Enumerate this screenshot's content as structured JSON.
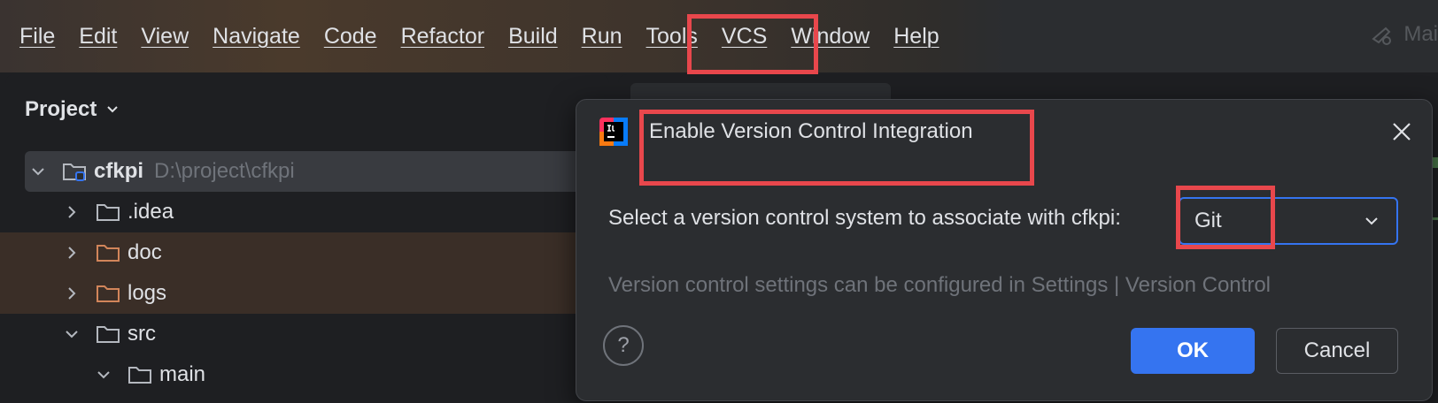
{
  "menubar": {
    "items": [
      "File",
      "Edit",
      "View",
      "Navigate",
      "Code",
      "Refactor",
      "Build",
      "Run",
      "Tools",
      "VCS",
      "Window",
      "Help"
    ],
    "right_label": "Mai",
    "right_icon": "run-config-icon"
  },
  "project": {
    "title": "Project",
    "tree": [
      {
        "label": "cfkpi",
        "path": "D:\\project\\cfkpi",
        "expanded": true,
        "bold": true,
        "icon": "module-folder-icon"
      },
      {
        "label": ".idea",
        "expanded": false,
        "icon": "folder-icon"
      },
      {
        "label": "doc",
        "expanded": false,
        "icon": "excluded-folder-icon"
      },
      {
        "label": "logs",
        "expanded": false,
        "icon": "excluded-folder-icon"
      },
      {
        "label": "src",
        "expanded": true,
        "icon": "folder-icon"
      },
      {
        "label": "main",
        "expanded": true,
        "icon": "folder-icon"
      }
    ]
  },
  "dialog": {
    "title": "Enable Version Control Integration",
    "label": "Select a version control system to associate with cfkpi:",
    "selected_vcs": "Git",
    "hint": "Version control settings can be configured in Settings | Version Control",
    "help": "?",
    "ok": "OK",
    "cancel": "Cancel"
  },
  "colors": {
    "accent": "#3574f0",
    "highlight": "#e8474c",
    "excluded_folder": "#d2855a"
  }
}
